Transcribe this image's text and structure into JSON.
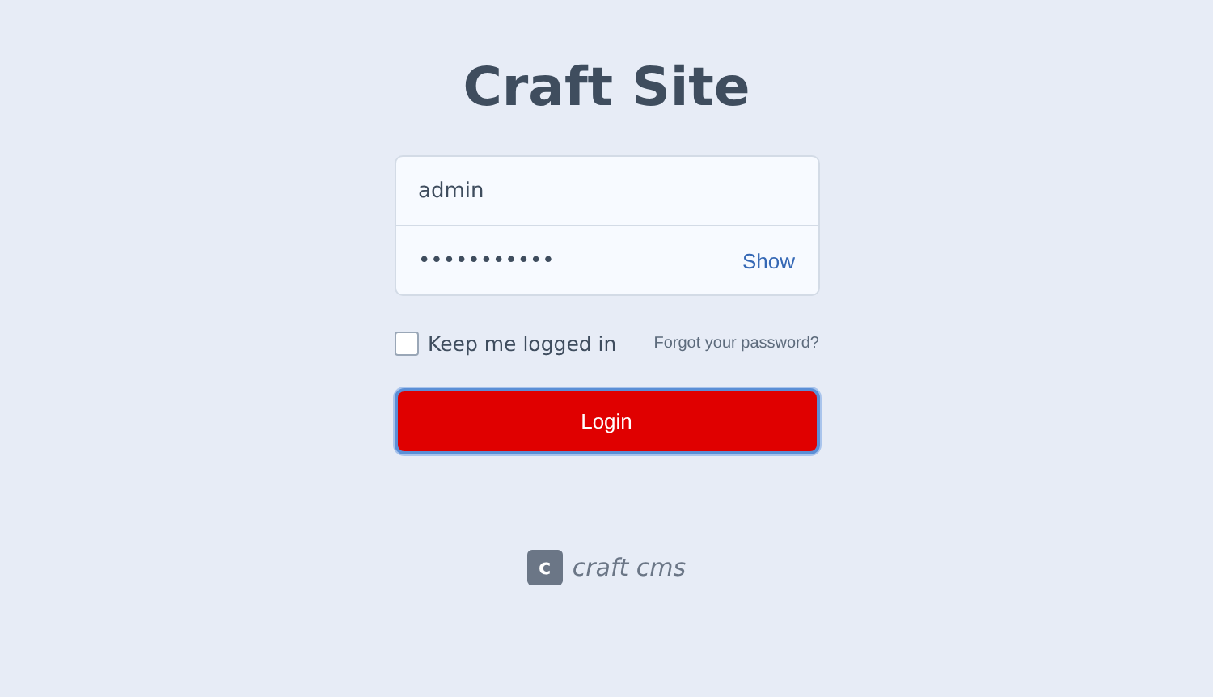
{
  "title": "Craft Site",
  "username": {
    "value": "admin"
  },
  "password": {
    "value": "•••••••••••",
    "toggle": "Show"
  },
  "remember": {
    "label": "Keep me logged in",
    "checked": false
  },
  "forgot_link": "Forgot your password?",
  "login_button": "Login",
  "footer_logo": {
    "mark": "c",
    "text": "craft cms"
  }
}
